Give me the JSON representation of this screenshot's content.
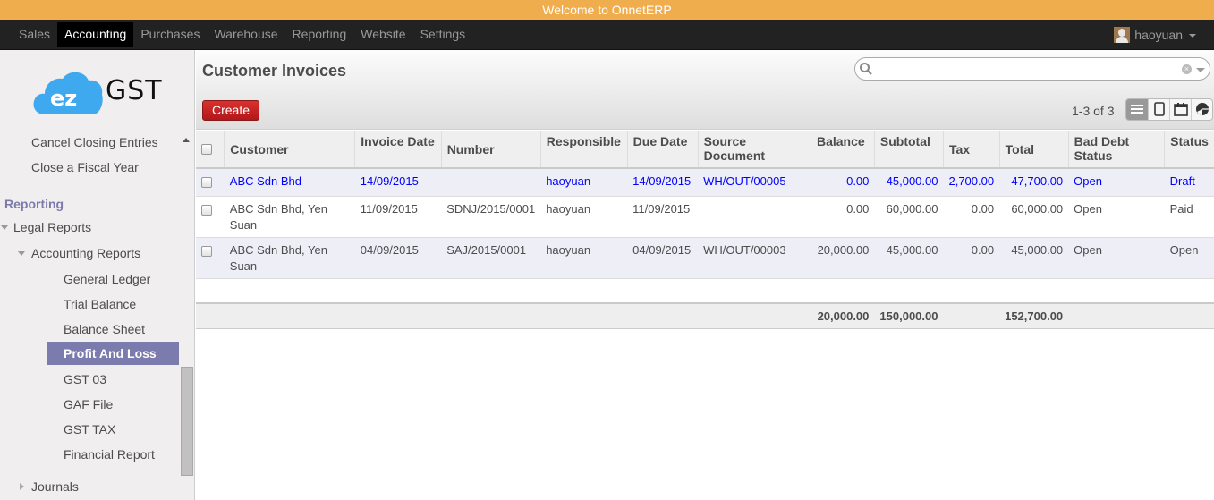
{
  "welcome": "Welcome to OnnetERP",
  "topmenu": {
    "items": [
      {
        "label": "Sales"
      },
      {
        "label": "Accounting"
      },
      {
        "label": "Purchases"
      },
      {
        "label": "Warehouse"
      },
      {
        "label": "Reporting"
      },
      {
        "label": "Website"
      },
      {
        "label": "Settings"
      }
    ],
    "active": "Accounting",
    "user": "haoyuan"
  },
  "sidebar": {
    "logo_text": "GST",
    "logo_badge": "ez",
    "items_top": [
      "Cancel Closing Entries",
      "Close a Fiscal Year"
    ],
    "section": "Reporting",
    "legal_reports": "Legal Reports",
    "accounting_reports": "Accounting Reports",
    "report_items": [
      "General Ledger",
      "Trial Balance",
      "Balance Sheet",
      "Profit And Loss",
      "GST 03",
      "GAF File",
      "GST TAX",
      "Financial Report"
    ],
    "active_item": "Profit And Loss",
    "journals": "Journals"
  },
  "main": {
    "title": "Customer Invoices",
    "create_label": "Create",
    "search_placeholder": "",
    "pager": "1-3 of 3",
    "views": [
      "list-view",
      "form-view",
      "calendar-view",
      "graph-view"
    ],
    "columns": [
      "Customer",
      "Invoice Date",
      "Number",
      "Responsible",
      "Due Date",
      "Source Document",
      "Balance",
      "Subtotal",
      "Tax",
      "Total",
      "Bad Debt Status",
      "Status"
    ],
    "rows": [
      {
        "customer": "ABC Sdn Bhd",
        "invoice_date": "14/09/2015",
        "number": "",
        "responsible": "haoyuan",
        "due_date": "14/09/2015",
        "source": "WH/OUT/00005",
        "balance": "0.00",
        "subtotal": "45,000.00",
        "tax": "2,700.00",
        "total": "47,700.00",
        "bad_debt": "Open",
        "status": "Draft"
      },
      {
        "customer": "ABC Sdn Bhd, Yen Suan",
        "invoice_date": "11/09/2015",
        "number": "SDNJ/2015/0001",
        "responsible": "haoyuan",
        "due_date": "11/09/2015",
        "source": "",
        "balance": "0.00",
        "subtotal": "60,000.00",
        "tax": "0.00",
        "total": "60,000.00",
        "bad_debt": "Open",
        "status": "Paid"
      },
      {
        "customer": "ABC Sdn Bhd, Yen Suan",
        "invoice_date": "04/09/2015",
        "number": "SAJ/2015/0001",
        "responsible": "haoyuan",
        "due_date": "04/09/2015",
        "source": "WH/OUT/00003",
        "balance": "20,000.00",
        "subtotal": "45,000.00",
        "tax": "0.00",
        "total": "45,000.00",
        "bad_debt": "Open",
        "status": "Open"
      }
    ],
    "totals": {
      "balance": "20,000.00",
      "subtotal": "150,000.00",
      "tax": "",
      "total": "152,700.00"
    }
  },
  "colors": {
    "welcome_bg": "#f0ad4e",
    "topbar_bg": "#222222",
    "accent_purple": "#7c7bad",
    "create_red": "#c9252a",
    "draft_blue": "#0000ff"
  }
}
